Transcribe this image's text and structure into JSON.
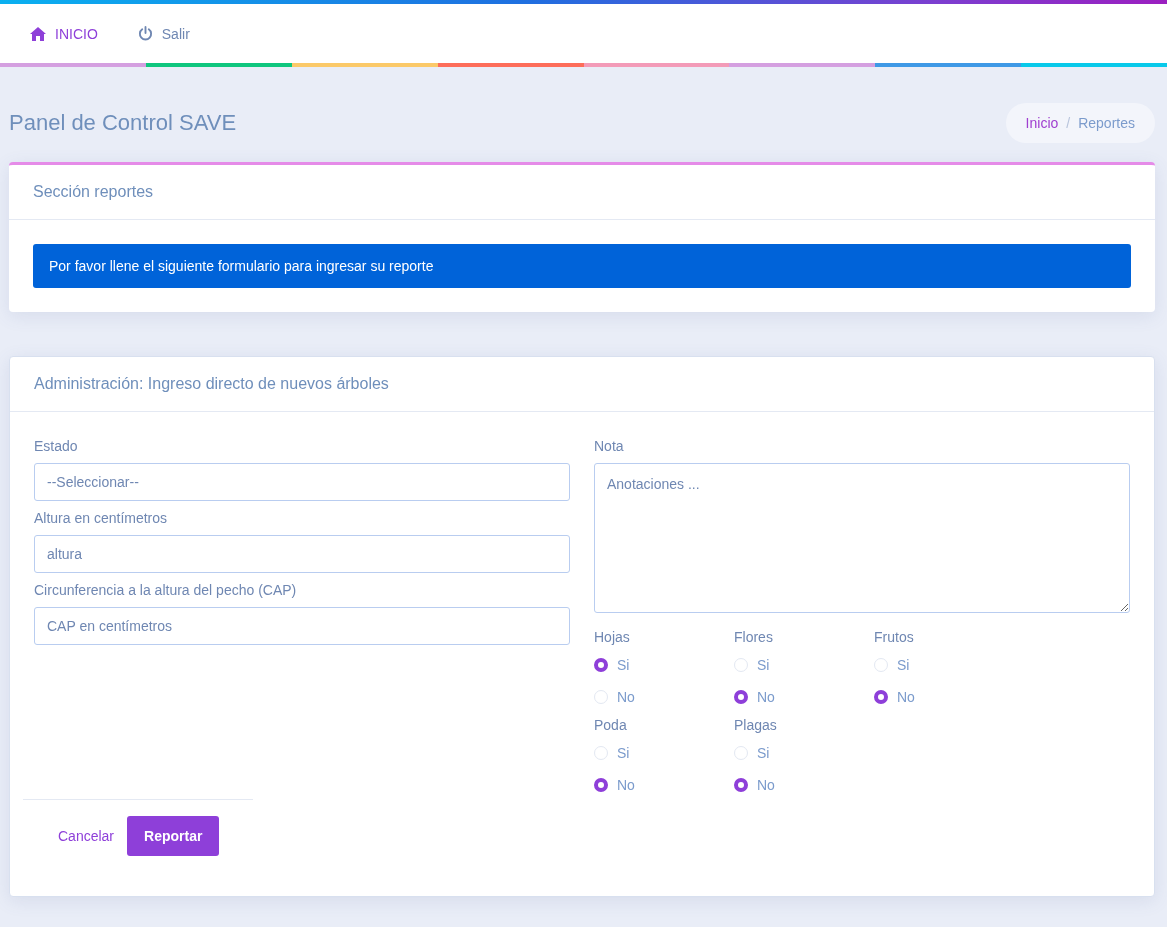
{
  "nav": {
    "items": [
      {
        "label": "INICIO",
        "selected": true
      },
      {
        "label": "Salir",
        "selected": false
      }
    ]
  },
  "header": {
    "title": "Panel de Control SAVE",
    "breadcrumb": [
      {
        "label": "Inicio",
        "kind": "link"
      },
      {
        "label": "/",
        "kind": "separator"
      },
      {
        "label": "Reportes",
        "kind": "current"
      }
    ]
  },
  "reports_card": {
    "title": "Sección reportes",
    "alert": "Por favor llene el siguiente formulario para ingresar su reporte"
  },
  "form_card": {
    "title": "Administración: Ingreso directo de nuevos árboles",
    "fields": [
      {
        "label": "Estado",
        "placeholder": "--Seleccionar--"
      },
      {
        "label": "Altura en centímetros",
        "placeholder": "altura"
      },
      {
        "label": "Circunferencia a la altura del pecho (CAP)",
        "placeholder": "CAP en centímetros"
      }
    ],
    "note": {
      "label": "Nota",
      "placeholder": "Anotaciones ..."
    },
    "radio_groups": [
      {
        "label": "Hojas",
        "options": [
          {
            "label": "Si",
            "selected": true
          },
          {
            "label": "No",
            "selected": false
          }
        ]
      },
      {
        "label": "Flores",
        "options": [
          {
            "label": "Si",
            "selected": false
          },
          {
            "label": "No",
            "selected": true
          }
        ]
      },
      {
        "label": "Frutos",
        "options": [
          {
            "label": "Si",
            "selected": false
          },
          {
            "label": "No",
            "selected": true
          }
        ]
      },
      {
        "label": "Poda",
        "options": [
          {
            "label": "Si",
            "selected": false
          },
          {
            "label": "No",
            "selected": true
          }
        ]
      },
      {
        "label": "Plagas",
        "options": [
          {
            "label": "Si",
            "selected": false
          },
          {
            "label": "No",
            "selected": true
          }
        ]
      }
    ],
    "buttons": [
      {
        "label": "Cancelar",
        "kind": "link"
      },
      {
        "label": "Reportar",
        "kind": "primary"
      }
    ]
  }
}
